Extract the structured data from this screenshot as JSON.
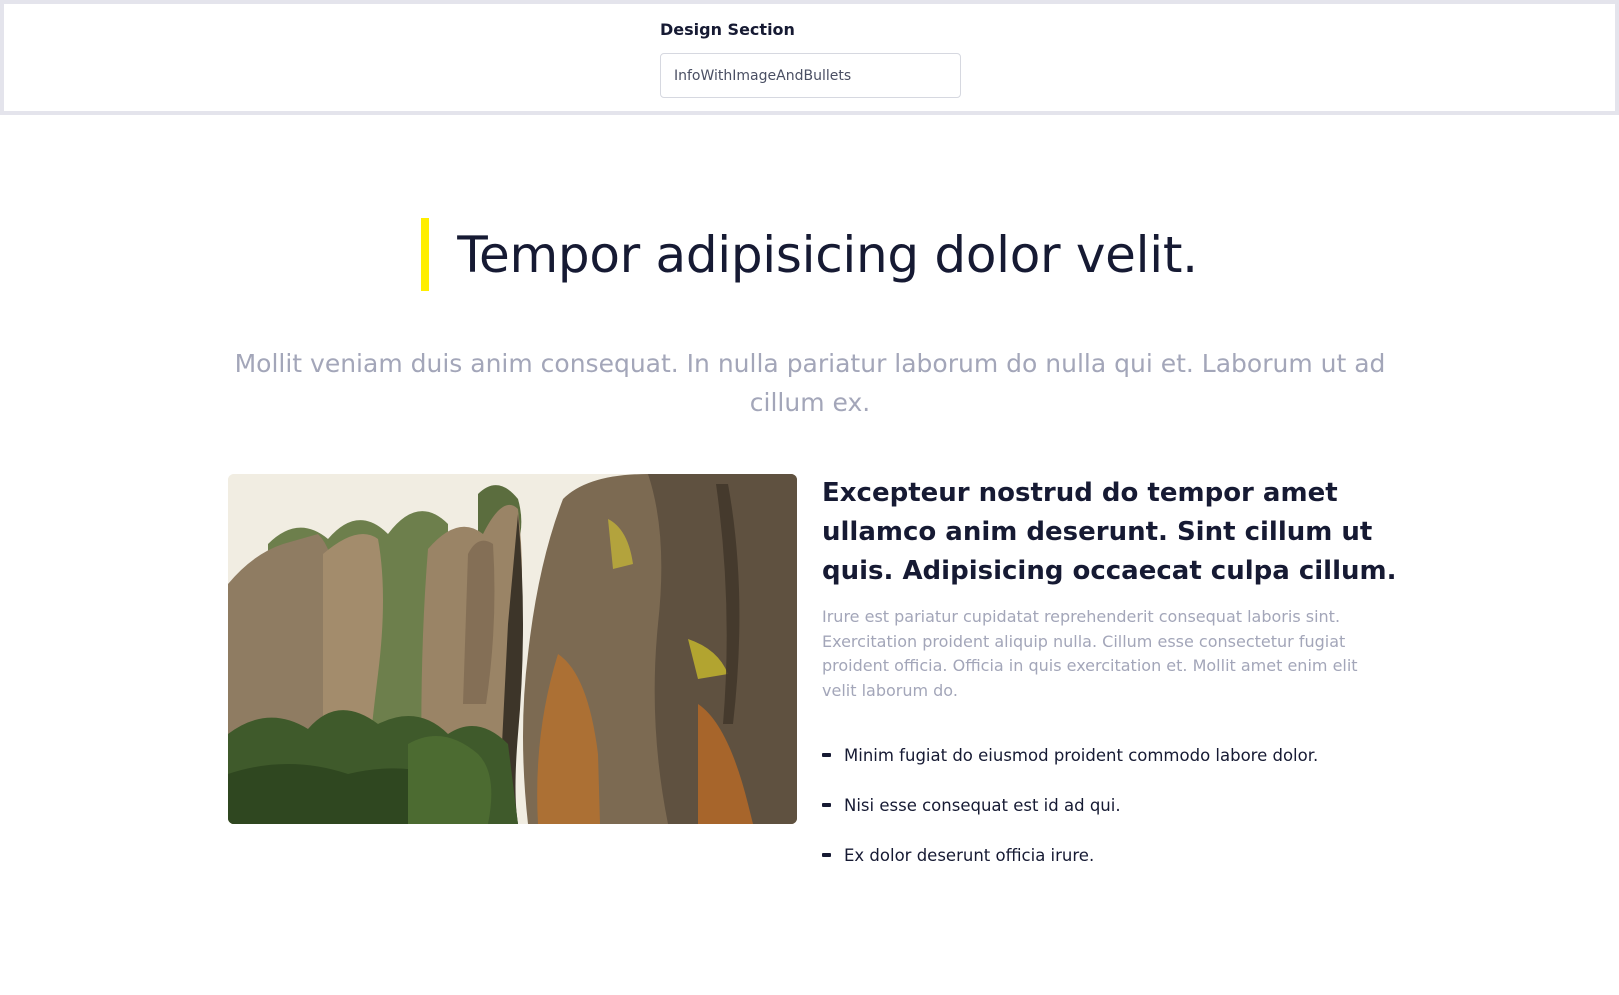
{
  "control_panel": {
    "label": "Design Section",
    "selected_value": "InfoWithImageAndBullets"
  },
  "section": {
    "headline": "Tempor adipisicing dolor velit.",
    "lead": "Mollit veniam duis anim consequat. In nulla pariatur laborum do nulla qui et. Laborum ut ad cillum ex.",
    "side_title": "Excepteur nostrud do tempor amet ullamco anim deserunt. Sint cillum ut quis. Adipisicing occaecat culpa cillum.",
    "side_body": "Irure est pariatur cupidatat reprehenderit consequat laboris sint. Exercitation proident aliquip nulla. Cillum esse consectetur fugiat proident officia. Officia in quis exercitation et. Mollit amet enim elit velit laborum do.",
    "bullets": [
      "Minim fugiat do eiusmod proident commodo labore dolor.",
      "Nisi esse consequat est id ad qui.",
      "Ex dolor deserunt officia irure."
    ]
  },
  "colors": {
    "accent_bar": "#ffee00",
    "heading": "#161a33",
    "muted_text": "#a3a6b9",
    "panel_border": "#e4e4ec"
  }
}
